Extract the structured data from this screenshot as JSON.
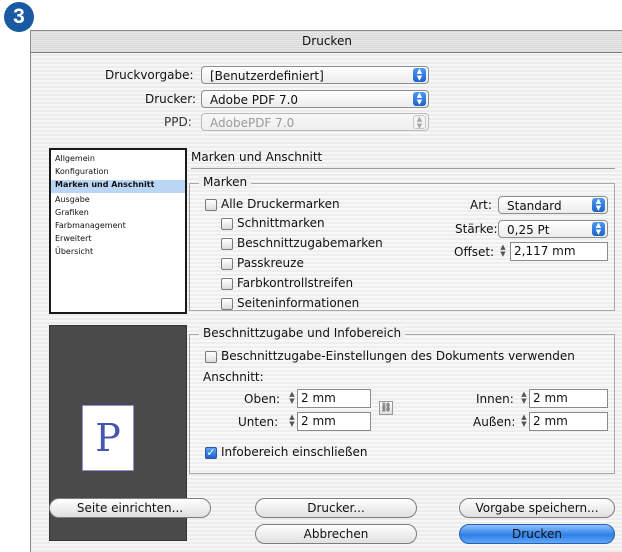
{
  "step_badge": "3",
  "window": {
    "title": "Drucken"
  },
  "top": {
    "druckvorgabe_label": "Druckvorgabe:",
    "druckvorgabe_value": "[Benutzerdefiniert]",
    "drucker_label": "Drucker:",
    "drucker_value": "Adobe PDF 7.0",
    "ppd_label": "PPD:",
    "ppd_value": "AdobePDF 7.0"
  },
  "sidebar": {
    "items": [
      {
        "label": "Allgemein",
        "selected": false
      },
      {
        "label": "Konfiguration",
        "selected": false
      },
      {
        "label": "Marken und Anschnitt",
        "selected": true
      },
      {
        "label": "Ausgabe",
        "selected": false
      },
      {
        "label": "Grafiken",
        "selected": false
      },
      {
        "label": "Farbmanagement",
        "selected": false
      },
      {
        "label": "Erweitert",
        "selected": false
      },
      {
        "label": "Übersicht",
        "selected": false
      }
    ]
  },
  "section_title": "Marken und Anschnitt",
  "marken": {
    "group_title": "Marken",
    "alle": {
      "label": "Alle Druckermarken",
      "checked": false
    },
    "checkboxes": [
      {
        "label": "Schnittmarken",
        "checked": false
      },
      {
        "label": "Beschnittzugabemarken",
        "checked": false
      },
      {
        "label": "Passkreuze",
        "checked": false
      },
      {
        "label": "Farbkontrollstreifen",
        "checked": false
      },
      {
        "label": "Seiteninformationen",
        "checked": false
      }
    ],
    "art_label": "Art:",
    "art_value": "Standard",
    "staerke_label": "Stärke:",
    "staerke_value": "0,25 Pt",
    "offset_label": "Offset:",
    "offset_value": "2,117 mm"
  },
  "anschnitt": {
    "group_title": "Beschnittzugabe und Infobereich",
    "use_doc": {
      "label": "Beschnittzugabe-Einstellungen des Dokuments verwenden",
      "checked": false
    },
    "anschnitt_label": "Anschnitt:",
    "oben_label": "Oben:",
    "oben_value": "2 mm",
    "unten_label": "Unten:",
    "unten_value": "2 mm",
    "innen_label": "Innen:",
    "innen_value": "2 mm",
    "aussen_label": "Außen:",
    "aussen_value": "2 mm",
    "infobereich": {
      "label": "Infobereich einschließen",
      "checked": true
    }
  },
  "preview": {
    "page_letter": "P"
  },
  "buttons": {
    "seite_einrichten": "Seite einrichten...",
    "drucker": "Drucker...",
    "vorgabe_speichern": "Vorgabe speichern...",
    "abbrechen": "Abbrechen",
    "drucken": "Drucken"
  }
}
